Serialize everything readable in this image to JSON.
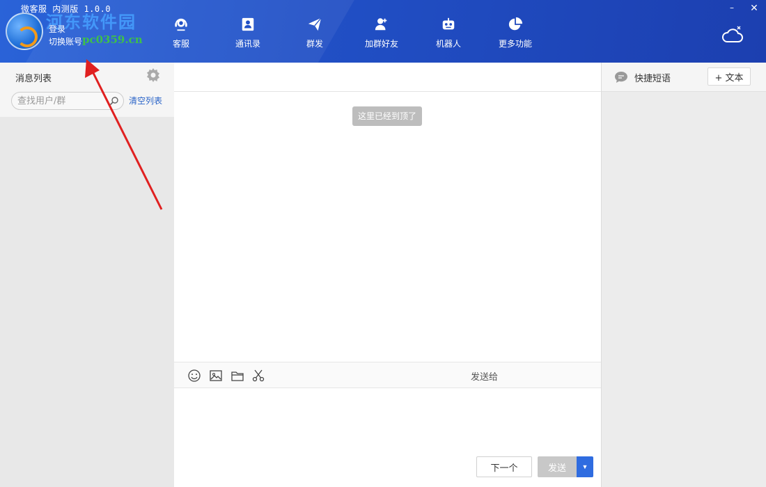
{
  "app": {
    "title": "微客服 内测版 1.0.0",
    "login": "登录",
    "switch_account": "切换账号",
    "watermark": "河东软件园",
    "watermark_url": "pc0359.cn"
  },
  "nav": [
    {
      "label": "客服",
      "icon": "headset-icon"
    },
    {
      "label": "通讯录",
      "icon": "contacts-icon"
    },
    {
      "label": "群发",
      "icon": "send-plane-icon"
    },
    {
      "label": "加群好友",
      "icon": "add-friend-icon"
    },
    {
      "label": "机器人",
      "icon": "robot-icon"
    },
    {
      "label": "更多功能",
      "icon": "pie-chart-icon"
    }
  ],
  "window": {
    "minimize": "–",
    "close": "✕"
  },
  "left_panel": {
    "title": "消息列表",
    "search_placeholder": "查找用户/群",
    "clear_list": "清空列表"
  },
  "chat": {
    "top_notice": "这里已经到顶了",
    "send_to_label": "发送给",
    "next_button": "下一个",
    "send_button": "发送",
    "send_dropdown": "▼"
  },
  "right_panel": {
    "title": "快捷短语",
    "add_text_button": "+ 文本"
  },
  "colors": {
    "header": "#2150c6",
    "accent": "#2f6ce0",
    "link": "#2a64c8",
    "annotation_arrow": "#e02020"
  }
}
